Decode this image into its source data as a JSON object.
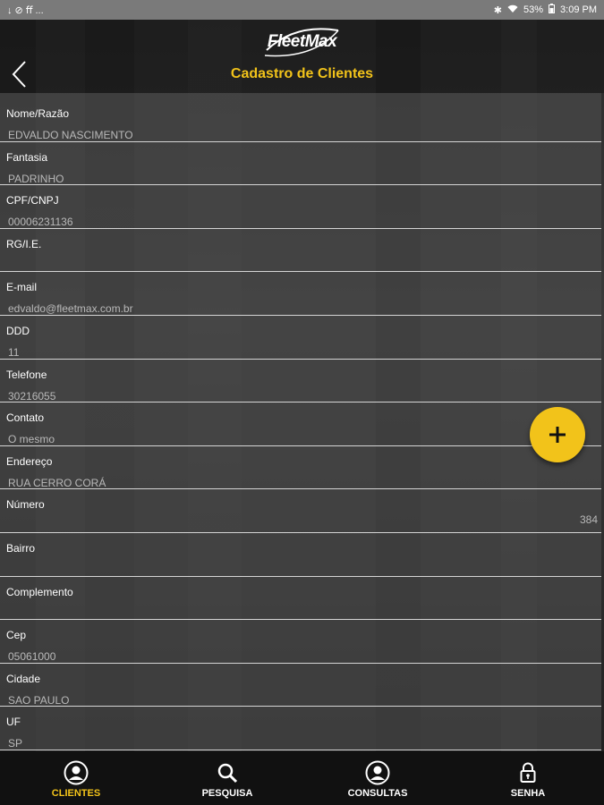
{
  "status_bar": {
    "left_icons": [
      "download-icon",
      "no-entry-icon",
      "ff-icon",
      "more-icon"
    ],
    "left_text": "↓  ⊘  ﬀ  ...",
    "battery": "53%",
    "time": "3:09 PM"
  },
  "header": {
    "logo": "FleetMax",
    "title": "Cadastro de Clientes"
  },
  "fields": [
    {
      "label": "Nome/Razão",
      "value": "EDVALDO NASCIMENTO"
    },
    {
      "label": "Fantasia",
      "value": "PADRINHO"
    },
    {
      "label": "CPF/CNPJ",
      "value": "00006231136"
    },
    {
      "label": "RG/I.E.",
      "value": ""
    },
    {
      "label": "E-mail",
      "value": "edvaldo@fleetmax.com.br"
    },
    {
      "label": "DDD",
      "value": "11"
    },
    {
      "label": "Telefone",
      "value": "30216055"
    },
    {
      "label": "Contato",
      "value": "O mesmo"
    },
    {
      "label": "Endereço",
      "value": "RUA CERRO CORÁ"
    },
    {
      "label": "Número",
      "value": "384"
    },
    {
      "label": "Bairro",
      "value": ""
    },
    {
      "label": "Complemento",
      "value": ""
    },
    {
      "label": "Cep",
      "value": "05061000"
    },
    {
      "label": "Cidade",
      "value": "SAO PAULO"
    },
    {
      "label": "UF",
      "value": "SP"
    }
  ],
  "fab": {
    "icon": "plus-icon"
  },
  "bottom_nav": [
    {
      "label": "CLIENTES",
      "icon": "user-circle-icon",
      "active": true
    },
    {
      "label": "PESQUISA",
      "icon": "search-icon",
      "active": false
    },
    {
      "label": "CONSULTAS",
      "icon": "user-circle-icon",
      "active": false
    },
    {
      "label": "SENHA",
      "icon": "lock-icon",
      "active": false
    }
  ],
  "colors": {
    "accent": "#f2c31a",
    "nav_background": "#111111",
    "form_background": "#484848"
  }
}
